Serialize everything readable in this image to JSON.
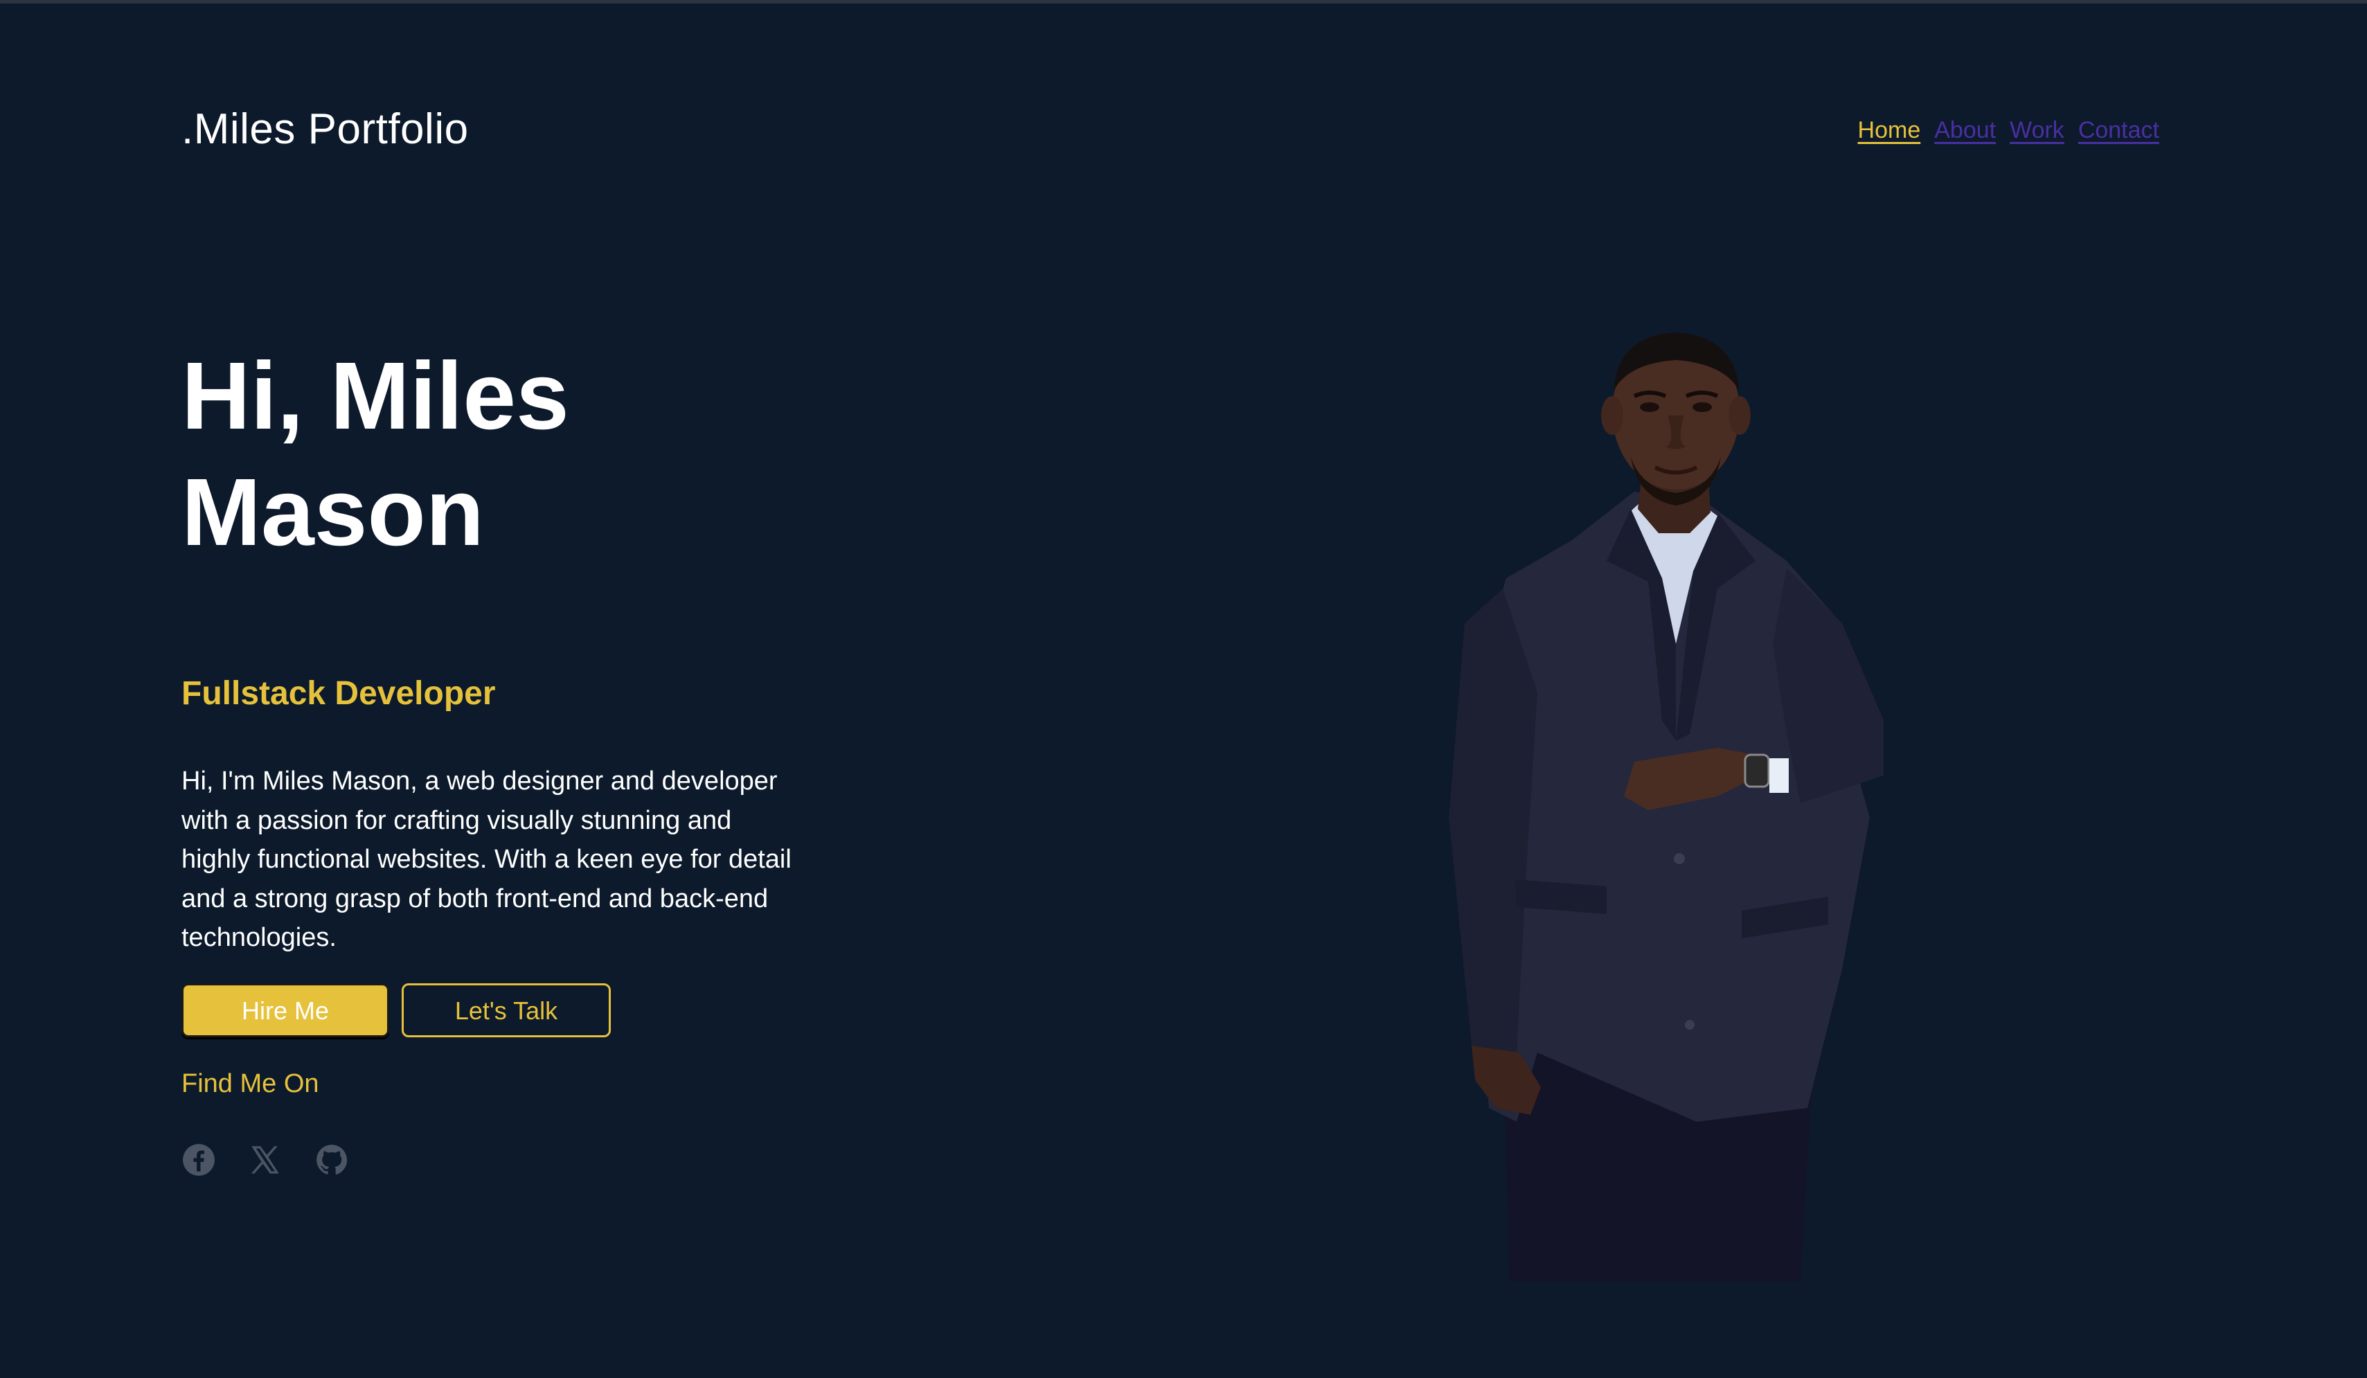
{
  "header": {
    "brand": ".Miles Portfolio",
    "nav": [
      {
        "label": "Home",
        "active": true
      },
      {
        "label": "About",
        "active": false
      },
      {
        "label": "Work",
        "active": false
      },
      {
        "label": "Contact",
        "active": false
      }
    ]
  },
  "hero": {
    "title_line1": "Hi, Miles",
    "title_line2": "Mason",
    "role": "Fullstack Developer",
    "intro_lines": [
      "Hi, I'm Miles Mason, a web designer and developer",
      "with a passion for crafting visually stunning and",
      "highly functional websites. With a keen eye for detail",
      "and a strong grasp of both front-end and back-end",
      "technologies."
    ],
    "hire_button": "Hire Me",
    "talk_button": "Let's Talk",
    "find_me_label": "Find Me On",
    "socials": [
      "facebook-icon",
      "x-icon",
      "github-icon"
    ]
  },
  "colors": {
    "background": "#0c1a2b",
    "accent": "#e6c13b",
    "nav_inactive": "#4a2fa3",
    "icon": "#4b5563"
  }
}
